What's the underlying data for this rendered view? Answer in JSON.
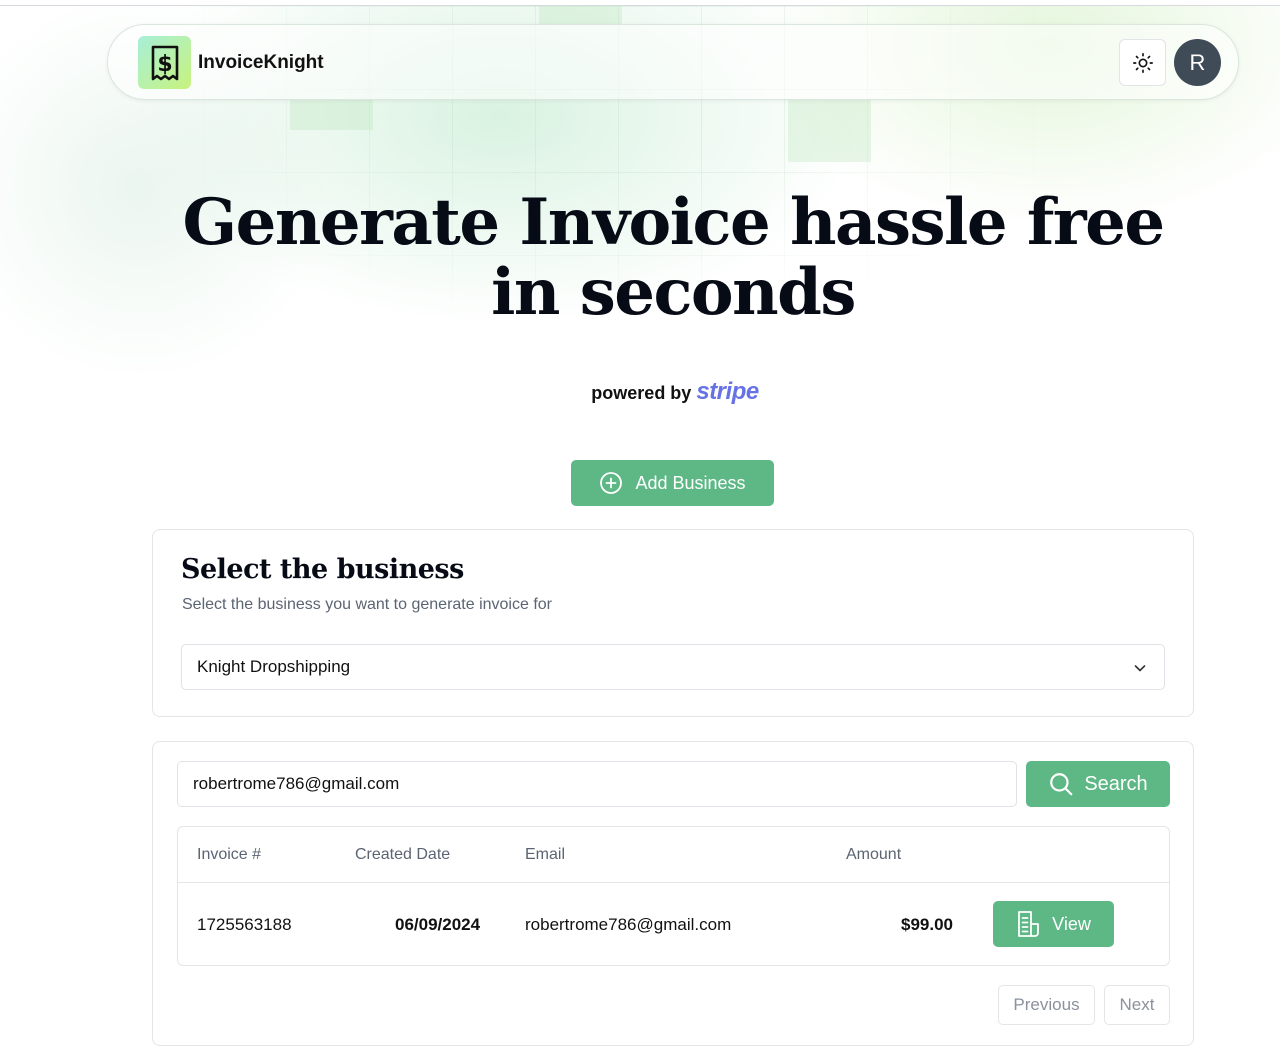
{
  "header": {
    "brand": "InvoiceKnight",
    "avatar_initial": "R",
    "icons": {
      "logo": "dollar-receipt-icon",
      "theme": "sun-icon"
    }
  },
  "hero": {
    "title_line1": "Generate Invoice hassle free",
    "title_line2": "in seconds",
    "powered_by": "powered by",
    "powered_brand": "stripe"
  },
  "add_business": {
    "label": "Add Business",
    "icon": "plus-circle-icon"
  },
  "business_card": {
    "title": "Select the business",
    "subtitle": "Select the business you want to generate invoice for",
    "selected": "Knight Dropshipping"
  },
  "search": {
    "value": "robertrome786@gmail.com",
    "button_label": "Search"
  },
  "table": {
    "headers": [
      "Invoice #",
      "Created Date",
      "Email",
      "Amount"
    ],
    "rows": [
      {
        "invoice": "1725563188",
        "created": "06/09/2024",
        "email": "robertrome786@gmail.com",
        "amount": "$99.00",
        "action": "View"
      }
    ]
  },
  "pagination": {
    "previous": "Previous",
    "next": "Next"
  },
  "colors": {
    "accent": "#5db886",
    "stripe": "#6772e5",
    "avatar_bg": "#3f4b57"
  }
}
